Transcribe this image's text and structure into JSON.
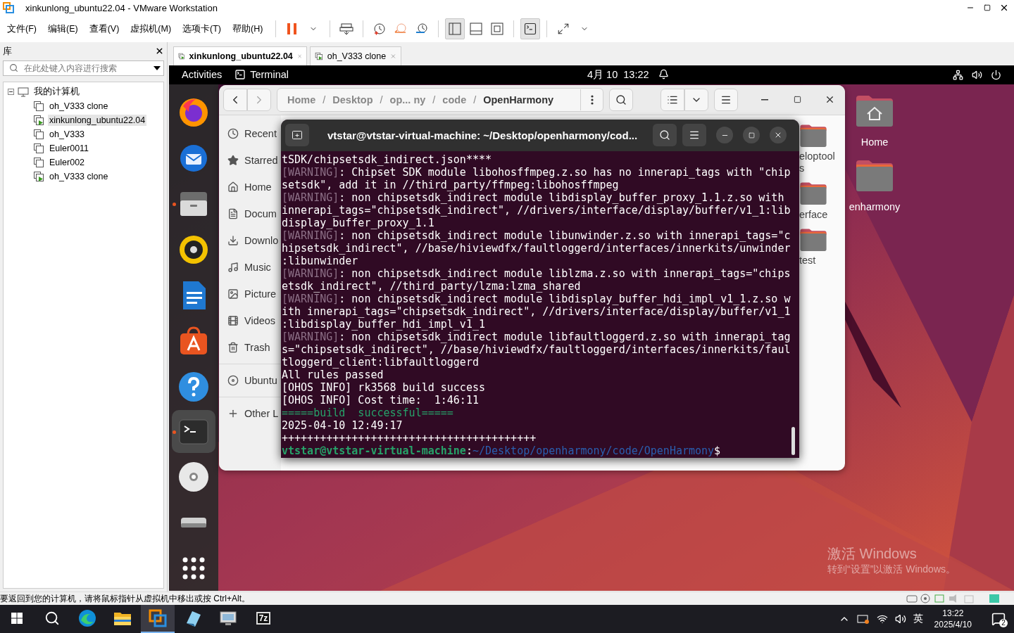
{
  "window": {
    "title": "xinkunlong_ubuntu22.04 - VMware Workstation"
  },
  "menu": [
    "文件(F)",
    "编辑(E)",
    "查看(V)",
    "虚拟机(M)",
    "选项卡(T)",
    "帮助(H)"
  ],
  "view_modes": [
    {
      "selected": true
    },
    {
      "selected": false
    },
    {
      "selected": false
    }
  ],
  "console_view": {
    "selected": true
  },
  "library": {
    "title": "库",
    "search": {
      "placeholder": "在此处键入内容进行搜索"
    },
    "tree": [
      {
        "label": "我的计算机",
        "expanded": true,
        "children": [
          {
            "label": "oh_V333 clone",
            "running": false,
            "selected": false
          },
          {
            "label": "xinkunlong_ubuntu22.04",
            "running": true,
            "selected": true
          },
          {
            "label": "oh_V333",
            "running": false,
            "selected": false
          },
          {
            "label": "Euler0011",
            "running": false,
            "selected": false
          },
          {
            "label": "Euler002",
            "running": false,
            "selected": false
          },
          {
            "label": "oh_V333 clone",
            "running": true,
            "selected": false
          }
        ]
      }
    ]
  },
  "vm_tabs": [
    {
      "label": "xinkunlong_ubuntu22.04",
      "selected": true,
      "running": true
    },
    {
      "label": "oh_V333 clone",
      "selected": false,
      "running": true
    }
  ],
  "top_bar": {
    "activities": "Activities",
    "app": "Terminal",
    "clock": "4月 10  13:22"
  },
  "dock": [
    {
      "kind": "browser",
      "running": false,
      "active": false
    },
    {
      "kind": "mail",
      "running": false,
      "active": false
    },
    {
      "kind": "files",
      "running": true,
      "active": false
    },
    {
      "kind": "music",
      "running": false,
      "active": false
    },
    {
      "kind": "writer",
      "running": false,
      "active": false
    },
    {
      "kind": "store",
      "running": false,
      "active": false
    },
    {
      "kind": "help",
      "running": false,
      "active": false
    },
    {
      "kind": "terminal",
      "running": true,
      "active": true
    },
    {
      "kind": "disc",
      "running": false,
      "active": false
    },
    {
      "kind": "drive",
      "running": false,
      "active": false
    },
    {
      "kind": "apps",
      "running": false,
      "active": false
    }
  ],
  "files_window": {
    "separator": "/",
    "path": [
      {
        "label": "Home",
        "current": false
      },
      {
        "label": "Desktop",
        "current": false
      },
      {
        "label": "op... ny",
        "current": false
      },
      {
        "label": "code",
        "current": false
      },
      {
        "label": "OpenHarmony",
        "current": true
      }
    ],
    "sidebar": [
      {
        "label": "Recent",
        "kind": "recent"
      },
      {
        "label": "Starred",
        "kind": "starred"
      },
      {
        "label": "Home",
        "kind": "home"
      },
      {
        "label": "Docum",
        "kind": "documents"
      },
      {
        "label": "Downlo",
        "kind": "downloads"
      },
      {
        "label": "Music",
        "kind": "music"
      },
      {
        "label": "Picture",
        "kind": "pictures"
      },
      {
        "label": "Videos",
        "kind": "videos"
      },
      {
        "label": "Trash",
        "kind": "trash"
      },
      {
        "label": "Ubuntu",
        "kind": "disc"
      },
      {
        "label": "Other L",
        "kind": "other"
      }
    ],
    "folders": [
      {
        "label": "eloptools"
      },
      {
        "label": "erface"
      },
      {
        "label": "test"
      }
    ]
  },
  "terminal": {
    "title": "vtstar@vtstar-virtual-machine: ~/Desktop/openharmony/cod...",
    "lines": [
      {
        "kind": "plain",
        "text": "tSDK/chipsetsdk_indirect.json****"
      },
      {
        "kind": "warning",
        "tag": "[WARNING]",
        "text": ": Chipset SDK module libohosffmpeg.z.so has no innerapi_tags with \"chip"
      },
      {
        "kind": "plain",
        "text": "setsdk\", add it in //third_party/ffmpeg:libohosffmpeg"
      },
      {
        "kind": "warning",
        "tag": "[WARNING]",
        "text": ": non chipsetsdk_indirect module libdisplay_buffer_proxy_1.1.z.so with"
      },
      {
        "kind": "plain",
        "text": "innerapi_tags=\"chipsetsdk_indirect\", //drivers/interface/display/buffer/v1_1:lib"
      },
      {
        "kind": "plain",
        "text": "display_buffer_proxy_1.1"
      },
      {
        "kind": "warning",
        "tag": "[WARNING]",
        "text": ": non chipsetsdk_indirect module libunwinder.z.so with innerapi_tags=\"c"
      },
      {
        "kind": "plain",
        "text": "hipsetsdk_indirect\", //base/hiviewdfx/faultloggerd/interfaces/innerkits/unwinder"
      },
      {
        "kind": "plain",
        "text": ":libunwinder"
      },
      {
        "kind": "warning",
        "tag": "[WARNING]",
        "text": ": non chipsetsdk_indirect module liblzma.z.so with innerapi_tags=\"chips"
      },
      {
        "kind": "plain",
        "text": "etsdk_indirect\", //third_party/lzma:lzma_shared"
      },
      {
        "kind": "warning",
        "tag": "[WARNING]",
        "text": ": non chipsetsdk_indirect module libdisplay_buffer_hdi_impl_v1_1.z.so w"
      },
      {
        "kind": "plain",
        "text": "ith innerapi_tags=\"chipsetsdk_indirect\", //drivers/interface/display/buffer/v1_1"
      },
      {
        "kind": "plain",
        "text": ":libdisplay_buffer_hdi_impl_v1_1"
      },
      {
        "kind": "warning",
        "tag": "[WARNING]",
        "text": ": non chipsetsdk_indirect module libfaultloggerd.z.so with innerapi_tag"
      },
      {
        "kind": "plain",
        "text": "s=\"chipsetsdk_indirect\", //base/hiviewdfx/faultloggerd/interfaces/innerkits/faul"
      },
      {
        "kind": "plain",
        "text": "tloggerd_client:libfaultloggerd"
      },
      {
        "kind": "plain",
        "text": "All rules passed"
      },
      {
        "kind": "plain",
        "text": "[OHOS INFO] rk3568 build success"
      },
      {
        "kind": "plain",
        "text": "[OHOS INFO] Cost time:  1:46:11"
      },
      {
        "kind": "success",
        "text": "=====build  successful====="
      },
      {
        "kind": "plain",
        "text": "2025-04-10 12:49:17"
      },
      {
        "kind": "plain",
        "text": "++++++++++++++++++++++++++++++++++++++++"
      },
      {
        "kind": "prompt",
        "user": "vtstar@vtstar-virtual-machine",
        "sep": ":",
        "path": "~/Desktop/openharmony/code/OpenHarmony",
        "symbol": "$"
      }
    ]
  },
  "desktop_icons": [
    {
      "label": "Home",
      "kind": "home"
    },
    {
      "label": "enharmony",
      "kind": "folder"
    }
  ],
  "activation": {
    "title": "激活 Windows",
    "subtitle": "转到“设置”以激活 Windows。"
  },
  "status_bar": {
    "message": "要返回到您的计算机，请将鼠标指针从虚拟机中移出或按 Ctrl+Alt。"
  },
  "taskbar": {
    "apps": [
      {
        "kind": "edge",
        "active": false
      },
      {
        "kind": "explorer",
        "active": false
      },
      {
        "kind": "vmware",
        "active": true
      },
      {
        "kind": "notepad",
        "active": false
      },
      {
        "kind": "monitor",
        "active": false
      },
      {
        "kind": "archiver",
        "active": false,
        "label": "7z"
      }
    ],
    "ime": "英",
    "time": "13:22",
    "date": "2025/4/10",
    "notifications": "2"
  }
}
